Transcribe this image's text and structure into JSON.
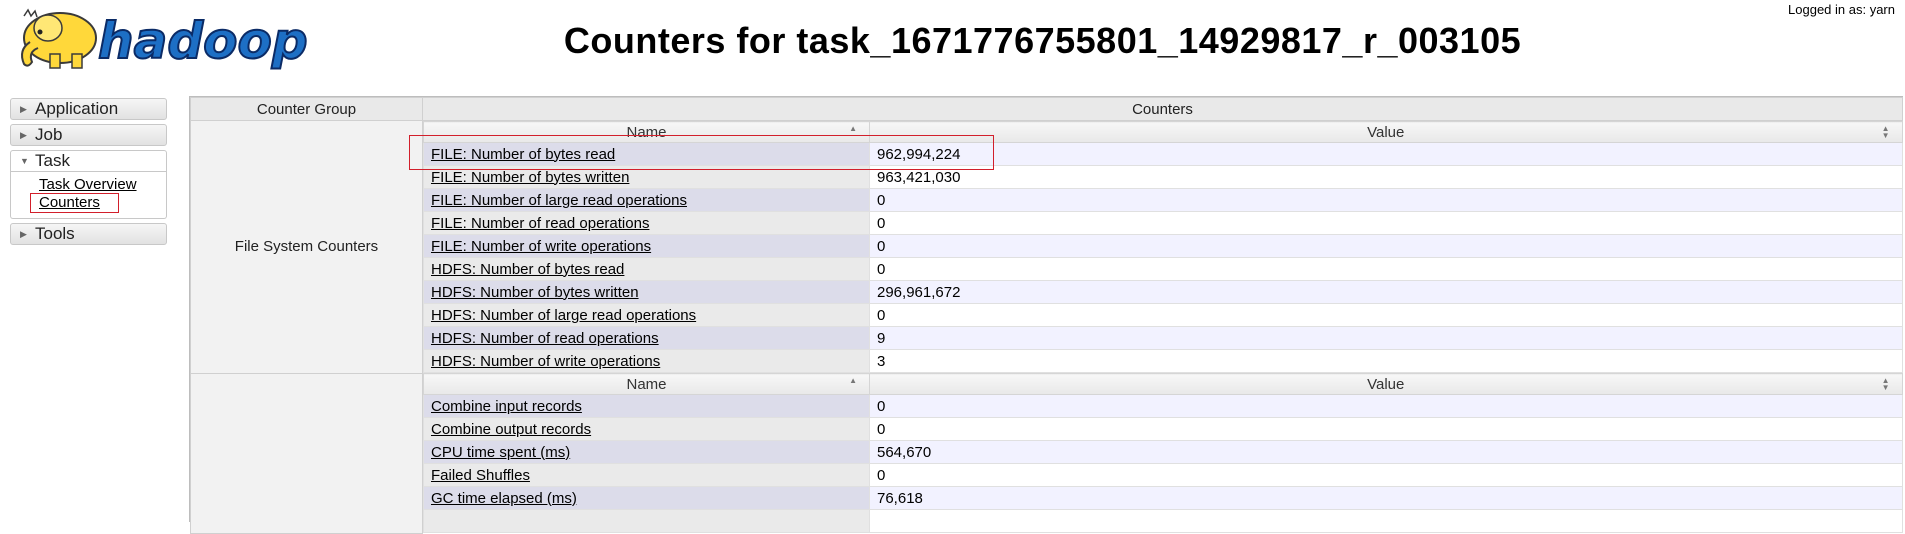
{
  "header": {
    "logo_text": "hadoop",
    "title": "Counters for task_1671776755801_14929817_r_003105",
    "login": "Logged in as: yarn"
  },
  "sidebar": {
    "items": [
      {
        "label": "Application",
        "open": false
      },
      {
        "label": "Job",
        "open": false
      },
      {
        "label": "Task",
        "open": true,
        "links": [
          "Task Overview",
          "Counters"
        ]
      },
      {
        "label": "Tools",
        "open": false
      }
    ]
  },
  "table": {
    "headers": {
      "group": "Counter Group",
      "counters": "Counters"
    },
    "groups": [
      {
        "name": "File System Counters",
        "columns": [
          "Name",
          "Value"
        ],
        "rows": [
          {
            "name": "FILE: Number of bytes read",
            "value": "962,994,224"
          },
          {
            "name": "FILE: Number of bytes written",
            "value": "963,421,030"
          },
          {
            "name": "FILE: Number of large read operations",
            "value": "0"
          },
          {
            "name": "FILE: Number of read operations",
            "value": "0"
          },
          {
            "name": "FILE: Number of write operations",
            "value": "0"
          },
          {
            "name": "HDFS: Number of bytes read",
            "value": "0"
          },
          {
            "name": "HDFS: Number of bytes written",
            "value": "296,961,672"
          },
          {
            "name": "HDFS: Number of large read operations",
            "value": "0"
          },
          {
            "name": "HDFS: Number of read operations",
            "value": "9"
          },
          {
            "name": "HDFS: Number of write operations",
            "value": "3"
          }
        ]
      },
      {
        "name": "",
        "columns": [
          "Name",
          "Value"
        ],
        "rows": [
          {
            "name": "Combine input records",
            "value": "0"
          },
          {
            "name": "Combine output records",
            "value": "0"
          },
          {
            "name": "CPU time spent (ms)",
            "value": "564,670"
          },
          {
            "name": "Failed Shuffles",
            "value": "0"
          },
          {
            "name": "GC time elapsed (ms)",
            "value": "76,618"
          },
          {
            "name": "",
            "value": ""
          }
        ]
      }
    ]
  }
}
